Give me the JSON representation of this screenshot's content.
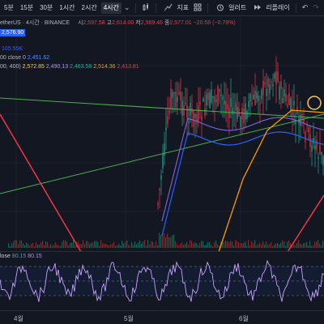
{
  "toolbar": {
    "timeframes": [
      "5분",
      "15분",
      "30분",
      "1시간",
      "2시간",
      "4시간"
    ],
    "active_timeframe": "4시간",
    "indicators_label": "지표",
    "alert_label": "얼러트",
    "replay_label": "리플레이"
  },
  "legend": {
    "symbol_title": "etherUS · 4시간 · BINANCE",
    "ohlc": {
      "o_label": "시",
      "o_value": "2,597.58",
      "h_label": "고",
      "h_value": "2,614.00",
      "l_label": "저",
      "l_value": "2,569.46",
      "c_label": "종",
      "c_value": "2,577.01",
      "change": "−20.58 (−0.79%)"
    },
    "price_box": "2,576.90",
    "volume": "105.55K",
    "ma_line1": {
      "label": "00 close 0",
      "value": "2,451.62"
    },
    "ma_line2": {
      "label": "00, 400)",
      "values": [
        "2,572.85",
        "2,490.13",
        "2,463.58",
        "2,514.36",
        "2,413.81"
      ]
    },
    "osc": {
      "label": "lose",
      "v1": "80.15",
      "v2": "80.15"
    }
  },
  "xaxis": {
    "labels": [
      "4월",
      "5월",
      "6월"
    ]
  },
  "colors": {
    "background": "#131722",
    "candle_up": "#22ab94",
    "candle_down": "#f23645",
    "ma_green": "#4caf50",
    "ma_blue": "#2962ff",
    "ma_orange": "#ff9800",
    "trend_red": "#f23645",
    "osc_line": "#c8a2ff"
  }
}
